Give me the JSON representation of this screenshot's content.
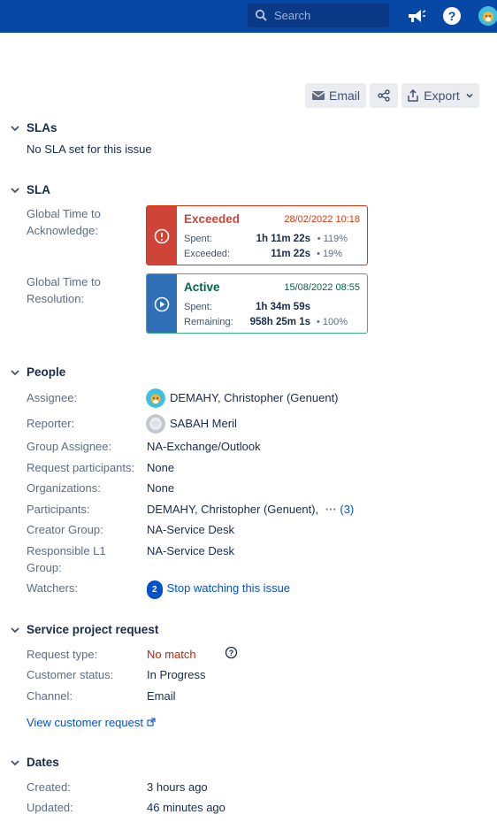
{
  "topbar": {
    "search_placeholder": "Search"
  },
  "actions": {
    "email": "Email",
    "export": "Export"
  },
  "slas_section": {
    "title": "SLAs",
    "empty_text": "No SLA set for this issue"
  },
  "sla_section": {
    "title": "SLA",
    "items": [
      {
        "label_line1": "Global Time to",
        "label_line2": "Acknowledge:",
        "state": "Exceeded",
        "date": "28/02/2022 10:18",
        "row1_label": "Spent:",
        "row1_value": "1h 11m 22s",
        "row1_pct": "• 119%",
        "row2_label": "Exceeded:",
        "row2_value": "11m 22s",
        "row2_pct": "• 19%",
        "color": "#de350b"
      },
      {
        "label_line1": "Global Time to",
        "label_line2": "Resolution:",
        "state": "Active",
        "date": "15/08/2022 08:55",
        "row1_label": "Spent:",
        "row1_value": "1h 34m 59s",
        "row1_pct": "",
        "row2_label": "Remaining:",
        "row2_value": "958h 25m 1s",
        "row2_pct": "• 100%",
        "color": "#2b6cb0",
        "state_color": "#006644"
      }
    ]
  },
  "people": {
    "title": "People",
    "assignee_label": "Assignee:",
    "assignee": "DEMAHY, Christopher (Genuent)",
    "reporter_label": "Reporter:",
    "reporter": "SABAH Meril",
    "group_assignee_label": "Group Assignee:",
    "group_assignee": "NA-Exchange/Outlook",
    "request_participants_label": "Request participants:",
    "request_participants": "None",
    "organizations_label": "Organizations:",
    "organizations": "None",
    "participants_label": "Participants:",
    "participants": "DEMAHY, Christopher (Genuent),",
    "participants_more": "(3)",
    "creator_group_label": "Creator Group:",
    "creator_group": "NA-Service Desk",
    "responsible_label_line1": "Responsible L1",
    "responsible_label_line2": "Group:",
    "responsible": "NA-Service Desk",
    "watchers_label": "Watchers:",
    "watchers_count": "2",
    "watchers_link": "Stop watching this issue"
  },
  "service_request": {
    "title": "Service project request",
    "request_type_label": "Request type:",
    "request_type": "No match",
    "customer_status_label": "Customer status:",
    "customer_status": "In Progress",
    "channel_label": "Channel:",
    "channel": "Email",
    "view_link": "View customer request"
  },
  "dates": {
    "title": "Dates",
    "created_label": "Created:",
    "created": "3 hours ago",
    "updated_label": "Updated:",
    "updated": "46 minutes ago"
  }
}
